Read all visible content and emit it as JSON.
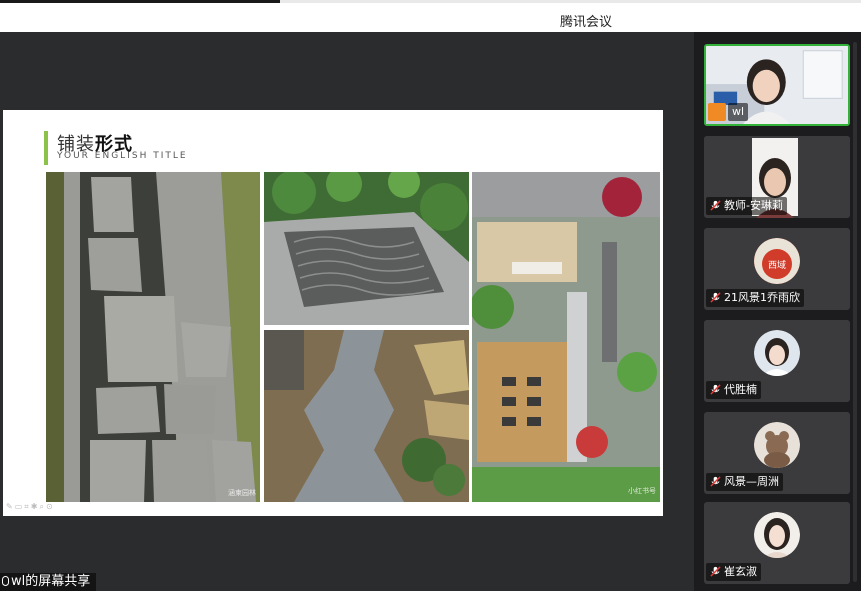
{
  "app": {
    "title": "腾讯会议"
  },
  "slide": {
    "title_light": "铺装",
    "title_bold": "形式",
    "subtitle": "YOUR ENGLISH TITLE",
    "watermark_left": "涵柬园林",
    "watermark_right": "小红书号"
  },
  "share": {
    "label": "wl的屏幕共享"
  },
  "participants": [
    {
      "name": "wl",
      "active": true
    },
    {
      "name": "教师-安琳莉",
      "active": false
    },
    {
      "name": "21风景1乔雨欣",
      "active": false,
      "avatar_text": "西域"
    },
    {
      "name": "代胜楠",
      "active": false
    },
    {
      "name": "风景—周洲",
      "active": false
    },
    {
      "name": "崔玄淑",
      "active": false
    }
  ],
  "colors": {
    "accent": "#8bc34a",
    "active_border": "#33b23a",
    "stage_bg": "#2b2c2e"
  }
}
